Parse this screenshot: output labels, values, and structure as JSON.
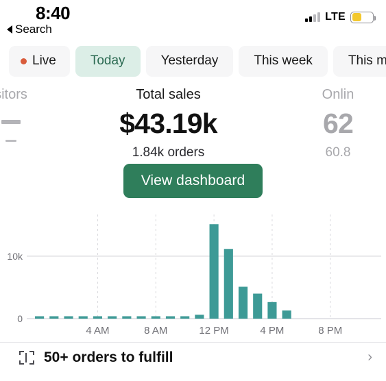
{
  "status_bar": {
    "time": "8:40",
    "back_label": "Search",
    "back_icon": "triangle-left-icon",
    "signal_icon": "cellular-signal-icon",
    "signal_bars_filled": 2,
    "signal_bars_total": 4,
    "network": "LTE",
    "battery_icon": "battery-low-power-icon",
    "battery_level_pct": 45,
    "battery_color": "#f3c82e"
  },
  "tabs": {
    "items": [
      {
        "label": "Live",
        "active": false,
        "has_dot": true,
        "dot_color": "#d95c3c"
      },
      {
        "label": "Today",
        "active": true,
        "has_dot": false
      },
      {
        "label": "Yesterday",
        "active": false,
        "has_dot": false
      },
      {
        "label": "This week",
        "active": false,
        "has_dot": false
      },
      {
        "label": "This m",
        "active": false,
        "has_dot": false
      }
    ],
    "active_bg": "#dceee7",
    "active_text": "#2b6a52",
    "inactive_bg": "#f6f6f7"
  },
  "metrics": {
    "left": {
      "title": "sitors",
      "value": "—",
      "sub": "–"
    },
    "center": {
      "title": "Total sales",
      "value": "$43.19k",
      "sub": "1.84k orders"
    },
    "right": {
      "title": "Onlin",
      "value": "62",
      "sub": "60.8"
    }
  },
  "primary_action": {
    "label": "View dashboard",
    "color": "#2f7e5b"
  },
  "chart_data": {
    "type": "bar",
    "title": "",
    "xlabel": "",
    "ylabel": "",
    "ylim": [
      0,
      16000
    ],
    "ytick_labels": [
      "0",
      "10k"
    ],
    "ytick_values": [
      0,
      10000
    ],
    "xtick_labels": [
      "4 AM",
      "8 AM",
      "12 PM",
      "4 PM",
      "8 PM"
    ],
    "xtick_hours": [
      4,
      8,
      12,
      16,
      20
    ],
    "grid": true,
    "grid_style": "dashed-vertical",
    "bar_color": "#3d9a96",
    "legend": "none",
    "categories": [
      "12 AM",
      "1 AM",
      "2 AM",
      "3 AM",
      "4 AM",
      "5 AM",
      "6 AM",
      "7 AM",
      "8 AM",
      "9 AM",
      "10 AM",
      "11 AM",
      "12 PM",
      "1 PM",
      "2 PM",
      "3 PM",
      "4 PM",
      "5 PM",
      "6 PM",
      "7 PM",
      "8 PM",
      "9 PM",
      "10 PM",
      "11 PM"
    ],
    "values": [
      190,
      190,
      220,
      30,
      190,
      200,
      190,
      190,
      200,
      190,
      190,
      620,
      15100,
      11150,
      5100,
      4000,
      2650,
      1300,
      0,
      0,
      0,
      0,
      0,
      0
    ]
  },
  "bottom_row": {
    "icon": "package-icon",
    "label": "50+ orders to fulfill",
    "chevron": "chevron-right-icon"
  }
}
